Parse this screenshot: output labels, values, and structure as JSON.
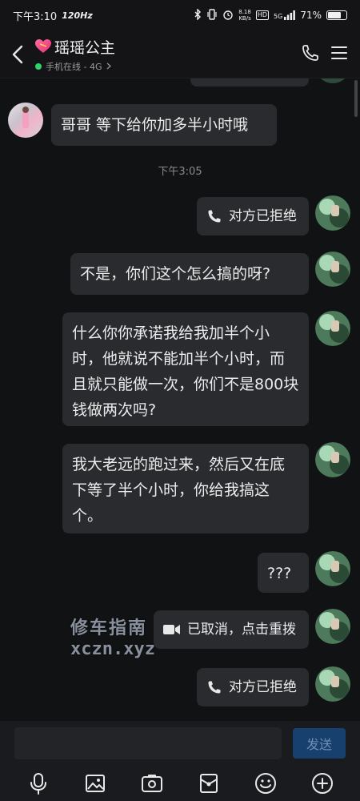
{
  "status_bar": {
    "time": "下午3:10",
    "refresh_rate": "120Hz",
    "net_speed_value": "8.18",
    "net_speed_unit": "KB/s",
    "hd": "HD",
    "signal": "5G",
    "battery": "71%",
    "battery_level": 0.71
  },
  "header": {
    "title": "瑶瑶公主",
    "subtitle": "手机在线 - 4G",
    "accent": "#2fd36a"
  },
  "chat": {
    "messages": [
      {
        "side": "left",
        "text": "哥哥 等下给你加多半小时哦"
      },
      {
        "type": "timestamp",
        "text": "下午3:05"
      },
      {
        "side": "right",
        "type": "call",
        "text": "对方已拒绝",
        "icon": "phone-icon"
      },
      {
        "side": "right",
        "text": "不是，你们这个怎么搞的呀?"
      },
      {
        "side": "right",
        "text": "什么你你承诺我给我加半个小时，他就说不能加半个小时，而且就只能做一次，你们不是800块钱做两次吗?"
      },
      {
        "side": "right",
        "text": "我大老远的跑过来，然后又在底下等了半个小时，你给我搞这个。"
      },
      {
        "side": "right",
        "text": "???"
      },
      {
        "side": "right",
        "type": "video-call",
        "text": "已取消，点击重拨",
        "icon": "video-icon"
      },
      {
        "side": "right",
        "type": "call",
        "text": "对方已拒绝",
        "icon": "phone-icon"
      }
    ]
  },
  "watermark": {
    "line1": "修车指南",
    "line2": "xczn.xyz"
  },
  "input": {
    "placeholder": "",
    "send_label": "发送",
    "send_color": "#17406e"
  },
  "toolbar": {
    "icons": [
      "microphone-icon",
      "image-icon",
      "camera-icon",
      "red-packet-icon",
      "emoji-icon",
      "plus-icon"
    ]
  }
}
